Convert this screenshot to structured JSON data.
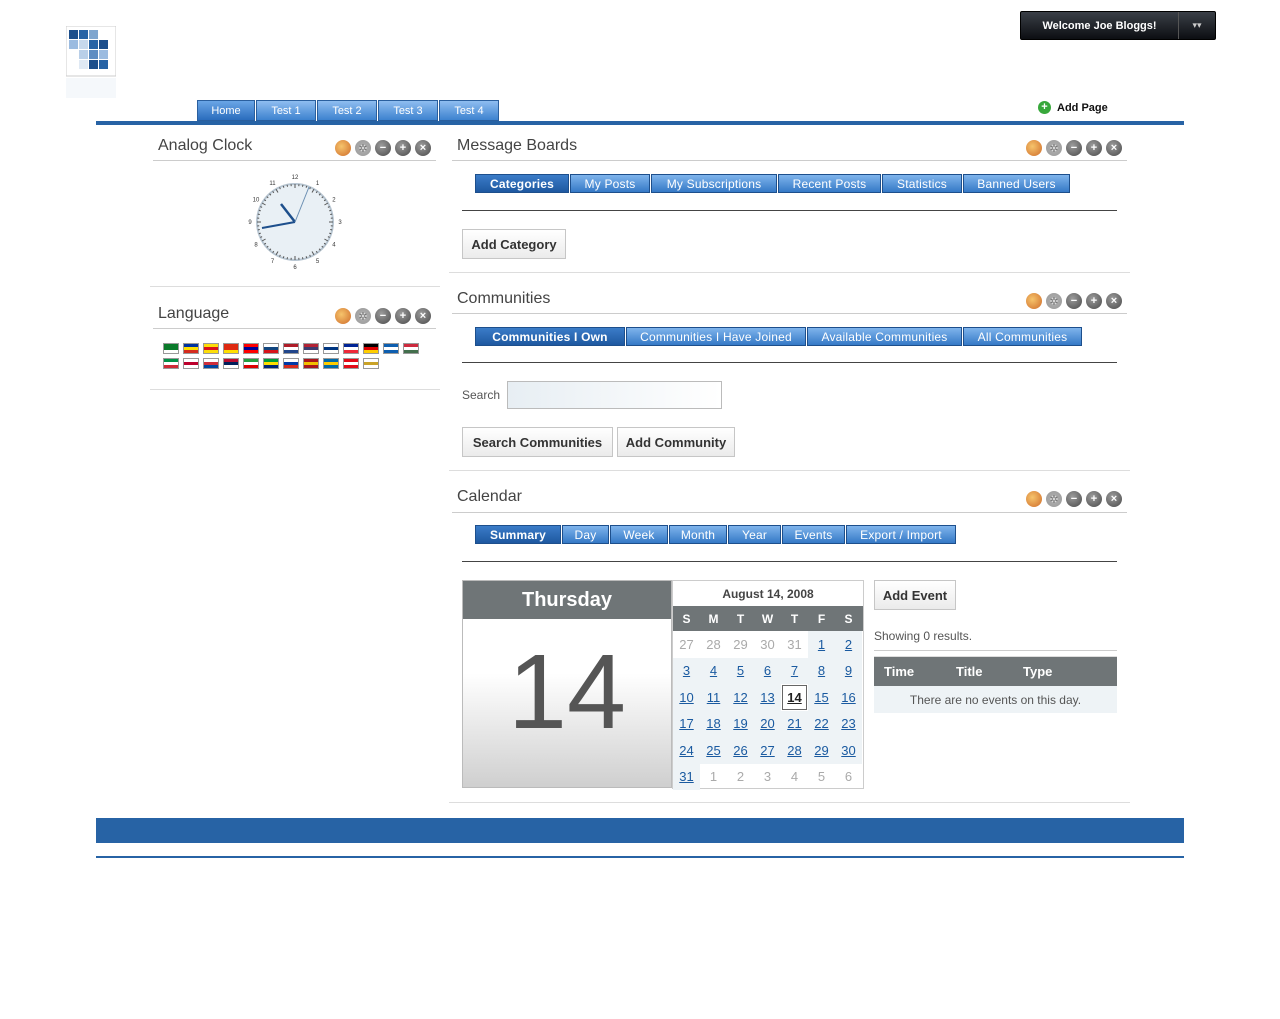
{
  "header": {
    "welcome_text": "Welcome Joe Bloggs!",
    "menu_icon": "chevron-down-icon",
    "add_page_label": "Add Page",
    "logo_icon": "checkerboard-logo"
  },
  "nav": {
    "tabs": [
      {
        "label": "Home",
        "selected": true
      },
      {
        "label": "Test 1"
      },
      {
        "label": "Test 2"
      },
      {
        "label": "Test 3"
      },
      {
        "label": "Test 4"
      }
    ]
  },
  "portlets": {
    "analog_clock": {
      "title": "Analog Clock",
      "clock_numerals": [
        "12",
        "1",
        "2",
        "3",
        "4",
        "5",
        "6",
        "7",
        "8",
        "9",
        "10",
        "11"
      ]
    },
    "language": {
      "title": "Language",
      "flags": [
        "Arabic",
        "Catalan",
        "Catalan-Spain",
        "Chinese",
        "Taiwanese",
        "Czech",
        "Dutch",
        "English",
        "Finnish",
        "French",
        "German",
        "Greek",
        "Hungarian",
        "Italian",
        "Japanese",
        "Korean",
        "Norwegian",
        "Persian",
        "Portuguese",
        "Russian",
        "Spanish",
        "Swedish",
        "Turkish",
        "Vietnamese"
      ]
    },
    "message_boards": {
      "title": "Message Boards",
      "tabs": [
        "Categories",
        "My Posts",
        "My Subscriptions",
        "Recent Posts",
        "Statistics",
        "Banned Users"
      ],
      "selected_tab": "Categories",
      "add_button": "Add Category"
    },
    "communities": {
      "title": "Communities",
      "tabs": [
        "Communities I Own",
        "Communities I Have Joined",
        "Available Communities",
        "All Communities"
      ],
      "selected_tab": "Communities I Own",
      "search_label": "Search",
      "search_value": "",
      "search_button": "Search Communities",
      "add_button": "Add Community"
    },
    "calendar": {
      "title": "Calendar",
      "tabs": [
        "Summary",
        "Day",
        "Week",
        "Month",
        "Year",
        "Events",
        "Export / Import"
      ],
      "selected_tab": "Summary",
      "day_name": "Thursday",
      "day_number": "14",
      "month_header": "August 14, 2008",
      "weekdays": [
        "S",
        "M",
        "T",
        "W",
        "T",
        "F",
        "S"
      ],
      "days": [
        {
          "n": "27",
          "t": "o"
        },
        {
          "n": "28",
          "t": "o"
        },
        {
          "n": "29",
          "t": "o"
        },
        {
          "n": "30",
          "t": "o"
        },
        {
          "n": "31",
          "t": "o"
        },
        {
          "n": "1",
          "t": "m"
        },
        {
          "n": "2",
          "t": "m"
        },
        {
          "n": "3",
          "t": "m"
        },
        {
          "n": "4",
          "t": "m"
        },
        {
          "n": "5",
          "t": "m"
        },
        {
          "n": "6",
          "t": "m"
        },
        {
          "n": "7",
          "t": "m"
        },
        {
          "n": "8",
          "t": "m"
        },
        {
          "n": "9",
          "t": "m"
        },
        {
          "n": "10",
          "t": "m"
        },
        {
          "n": "11",
          "t": "m"
        },
        {
          "n": "12",
          "t": "m"
        },
        {
          "n": "13",
          "t": "m"
        },
        {
          "n": "14",
          "t": "t"
        },
        {
          "n": "15",
          "t": "m"
        },
        {
          "n": "16",
          "t": "m"
        },
        {
          "n": "17",
          "t": "m"
        },
        {
          "n": "18",
          "t": "m"
        },
        {
          "n": "19",
          "t": "m"
        },
        {
          "n": "20",
          "t": "m"
        },
        {
          "n": "21",
          "t": "m"
        },
        {
          "n": "22",
          "t": "m"
        },
        {
          "n": "23",
          "t": "m"
        },
        {
          "n": "24",
          "t": "m"
        },
        {
          "n": "25",
          "t": "m"
        },
        {
          "n": "26",
          "t": "m"
        },
        {
          "n": "27",
          "t": "m"
        },
        {
          "n": "28",
          "t": "m"
        },
        {
          "n": "29",
          "t": "m"
        },
        {
          "n": "30",
          "t": "m"
        },
        {
          "n": "31",
          "t": "m"
        },
        {
          "n": "1",
          "t": "o"
        },
        {
          "n": "2",
          "t": "o"
        },
        {
          "n": "3",
          "t": "o"
        },
        {
          "n": "4",
          "t": "o"
        },
        {
          "n": "5",
          "t": "o"
        },
        {
          "n": "6",
          "t": "o"
        }
      ],
      "add_event_button": "Add Event",
      "showing_text": "Showing 0 results.",
      "event_columns": [
        "Time",
        "Title",
        "Type"
      ],
      "no_events_text": "There are no events on this day."
    }
  },
  "colors": {
    "brand_blue": "#2763a5",
    "tab_blue": "#3d82cf",
    "header_gray": "#6f7577"
  },
  "portlet_icons": [
    "look-and-feel-icon",
    "configuration-icon",
    "minimize-icon",
    "maximize-icon",
    "close-icon"
  ]
}
